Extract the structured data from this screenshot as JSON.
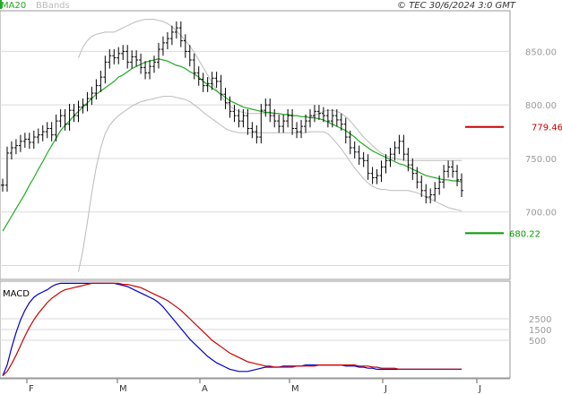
{
  "header": {
    "legend_ma": "MA20",
    "legend_bb": "BBands",
    "copyright": "© TEC 30/6/2024 3:0 GMT"
  },
  "colors": {
    "price": "#000000",
    "ma": "#22aa22",
    "bbands": "#bbbbbb",
    "grid": "#d9d9d9",
    "resistance": "#cc0000",
    "support": "#009900",
    "macd": "#0000cc",
    "signal": "#cc0000"
  },
  "chart_data": [
    {
      "type": "line",
      "panel": "price",
      "y_ticks": [
        "850.00",
        "800.00",
        "750.00",
        "700.00"
      ],
      "y_tick_values": [
        850,
        800,
        750,
        700
      ],
      "ylim": [
        637,
        888
      ],
      "x_ticks": [
        "F",
        "M",
        "A",
        "M",
        "J",
        "J"
      ],
      "levels": [
        {
          "label": "779.46",
          "value": 779.46,
          "role": "resistance"
        },
        {
          "label": "680.22",
          "value": 680.22,
          "role": "support"
        }
      ],
      "series": [
        {
          "role": "price",
          "values": [
            725,
            755,
            760,
            762,
            766,
            768,
            765,
            770,
            772,
            775,
            778,
            772,
            785,
            790,
            782,
            795,
            790,
            798,
            800,
            806,
            811,
            818,
            826,
            840,
            846,
            844,
            848,
            850,
            840,
            845,
            842,
            835,
            830,
            836,
            840,
            852,
            858,
            862,
            868,
            872,
            860,
            850,
            842,
            830,
            824,
            818,
            820,
            825,
            822,
            810,
            802,
            794,
            790,
            785,
            790,
            778,
            775,
            770,
            795,
            800,
            790,
            785,
            780,
            785,
            790,
            778,
            775,
            780,
            785,
            790,
            794,
            792,
            790,
            785,
            790,
            786,
            782,
            770,
            760,
            756,
            750,
            748,
            736,
            732,
            734,
            742,
            748,
            754,
            760,
            766,
            754,
            744,
            736,
            728,
            720,
            714,
            716,
            722,
            728,
            738,
            742,
            738,
            730,
            720
          ]
        },
        {
          "role": "ma20",
          "values": [
            682,
            689,
            696,
            703,
            710,
            717,
            725,
            732,
            740,
            747,
            755,
            762,
            769,
            776,
            781,
            785,
            790,
            794,
            798,
            802,
            806,
            810,
            813,
            816,
            819,
            822,
            826,
            828,
            831,
            834,
            836,
            838,
            840,
            841,
            842,
            843,
            842,
            841,
            839,
            837,
            836,
            834,
            831,
            829,
            826,
            822,
            819,
            816,
            813,
            810,
            807,
            804,
            802,
            800,
            798,
            797,
            796,
            795,
            794,
            793,
            793,
            792,
            792,
            791,
            791,
            790,
            790,
            789,
            789,
            788,
            788,
            787,
            786,
            784,
            782,
            780,
            778,
            776,
            773,
            770,
            766,
            763,
            760,
            757,
            755,
            753,
            751,
            749,
            747,
            745,
            744,
            742,
            740,
            738,
            736,
            734,
            733,
            732,
            731,
            730,
            730,
            729,
            729,
            728
          ]
        },
        {
          "role": "bb_upper",
          "values": [
            null,
            null,
            null,
            null,
            null,
            null,
            null,
            null,
            null,
            null,
            null,
            null,
            null,
            null,
            null,
            null,
            null,
            844,
            854,
            860,
            864,
            866,
            867,
            868,
            868,
            868,
            870,
            872,
            874,
            876,
            878,
            879,
            880,
            880,
            880,
            879,
            878,
            876,
            873,
            869,
            865,
            860,
            855,
            849,
            842,
            835,
            828,
            821,
            814,
            808,
            803,
            799,
            796,
            794,
            793,
            792,
            792,
            792,
            792,
            792,
            792,
            792,
            792,
            791,
            791,
            790,
            790,
            789,
            789,
            788,
            790,
            792,
            794,
            795,
            795,
            794,
            792,
            789,
            785,
            780,
            775,
            770,
            766,
            762,
            758,
            755,
            753,
            751,
            750,
            749,
            748,
            748,
            748,
            748,
            748,
            748,
            748,
            748,
            748,
            748,
            748,
            748,
            748,
            748
          ]
        },
        {
          "role": "bb_lower",
          "values": [
            null,
            null,
            null,
            null,
            null,
            null,
            null,
            null,
            null,
            null,
            null,
            null,
            null,
            null,
            null,
            null,
            null,
            644,
            664,
            690,
            718,
            742,
            760,
            773,
            781,
            786,
            790,
            793,
            796,
            799,
            801,
            803,
            804,
            805,
            806,
            807,
            808,
            808,
            808,
            807,
            806,
            805,
            803,
            800,
            797,
            793,
            790,
            787,
            784,
            781,
            778,
            776,
            775,
            774,
            774,
            774,
            774,
            774,
            774,
            774,
            774,
            774,
            774,
            774,
            774,
            774,
            774,
            774,
            774,
            775,
            775,
            775,
            775,
            773,
            769,
            764,
            759,
            753,
            747,
            741,
            736,
            731,
            727,
            724,
            722,
            721,
            721,
            720,
            720,
            720,
            720,
            720,
            719,
            718,
            716,
            714,
            712,
            710,
            708,
            706,
            704,
            703,
            702,
            701
          ]
        }
      ]
    },
    {
      "type": "line",
      "panel": "macd",
      "title": "MACD",
      "y_ticks": [
        "2500",
        "1500",
        "500"
      ],
      "y_tick_values": [
        25,
        15,
        5
      ],
      "ylim": [
        -30,
        60
      ],
      "series": [
        {
          "role": "macd",
          "values": [
            -28,
            -18,
            -2,
            12,
            24,
            33,
            40,
            45,
            48,
            50,
            52,
            55,
            57,
            58,
            58,
            58,
            58,
            58,
            58,
            58,
            58,
            58,
            58,
            58,
            58,
            58,
            57,
            56,
            55,
            53,
            51,
            49,
            47,
            45,
            43,
            40,
            36,
            31,
            26,
            21,
            16,
            11,
            6,
            2,
            -2,
            -6,
            -10,
            -13,
            -16,
            -18,
            -20,
            -22,
            -23,
            -24,
            -24,
            -24,
            -23,
            -22,
            -21,
            -20,
            -20,
            -20,
            -20,
            -19,
            -19,
            -19,
            -19,
            -19,
            -18,
            -18,
            -18,
            -18,
            -18,
            -18,
            -18,
            -18,
            -18,
            -19,
            -19,
            -19,
            -20,
            -20,
            -21,
            -21,
            -22,
            -22,
            -22,
            -22,
            -22,
            -22,
            -22,
            -22,
            -22,
            -22,
            -22,
            -22,
            -22,
            -22,
            -22,
            -22,
            -22,
            -22,
            -22,
            -22
          ]
        },
        {
          "role": "signal",
          "values": [
            -28,
            -24,
            -17,
            -9,
            0,
            9,
            17,
            24,
            30,
            35,
            40,
            44,
            47,
            50,
            52,
            53,
            54,
            55,
            56,
            57,
            58,
            58,
            58,
            58,
            58,
            58,
            58,
            57,
            57,
            56,
            55,
            54,
            52,
            50,
            48,
            46,
            44,
            42,
            39,
            36,
            33,
            29,
            25,
            21,
            17,
            13,
            9,
            5,
            2,
            -1,
            -4,
            -7,
            -9,
            -11,
            -13,
            -15,
            -16,
            -17,
            -18,
            -19,
            -19,
            -20,
            -20,
            -20,
            -20,
            -20,
            -19,
            -19,
            -19,
            -19,
            -19,
            -18,
            -18,
            -18,
            -18,
            -18,
            -18,
            -18,
            -18,
            -18,
            -19,
            -19,
            -19,
            -20,
            -20,
            -21,
            -21,
            -21,
            -21,
            -22,
            -22,
            -22,
            -22,
            -22,
            -22,
            -22,
            -22,
            -22,
            -22,
            -22,
            -22,
            -22,
            -22,
            -22
          ]
        }
      ]
    }
  ]
}
